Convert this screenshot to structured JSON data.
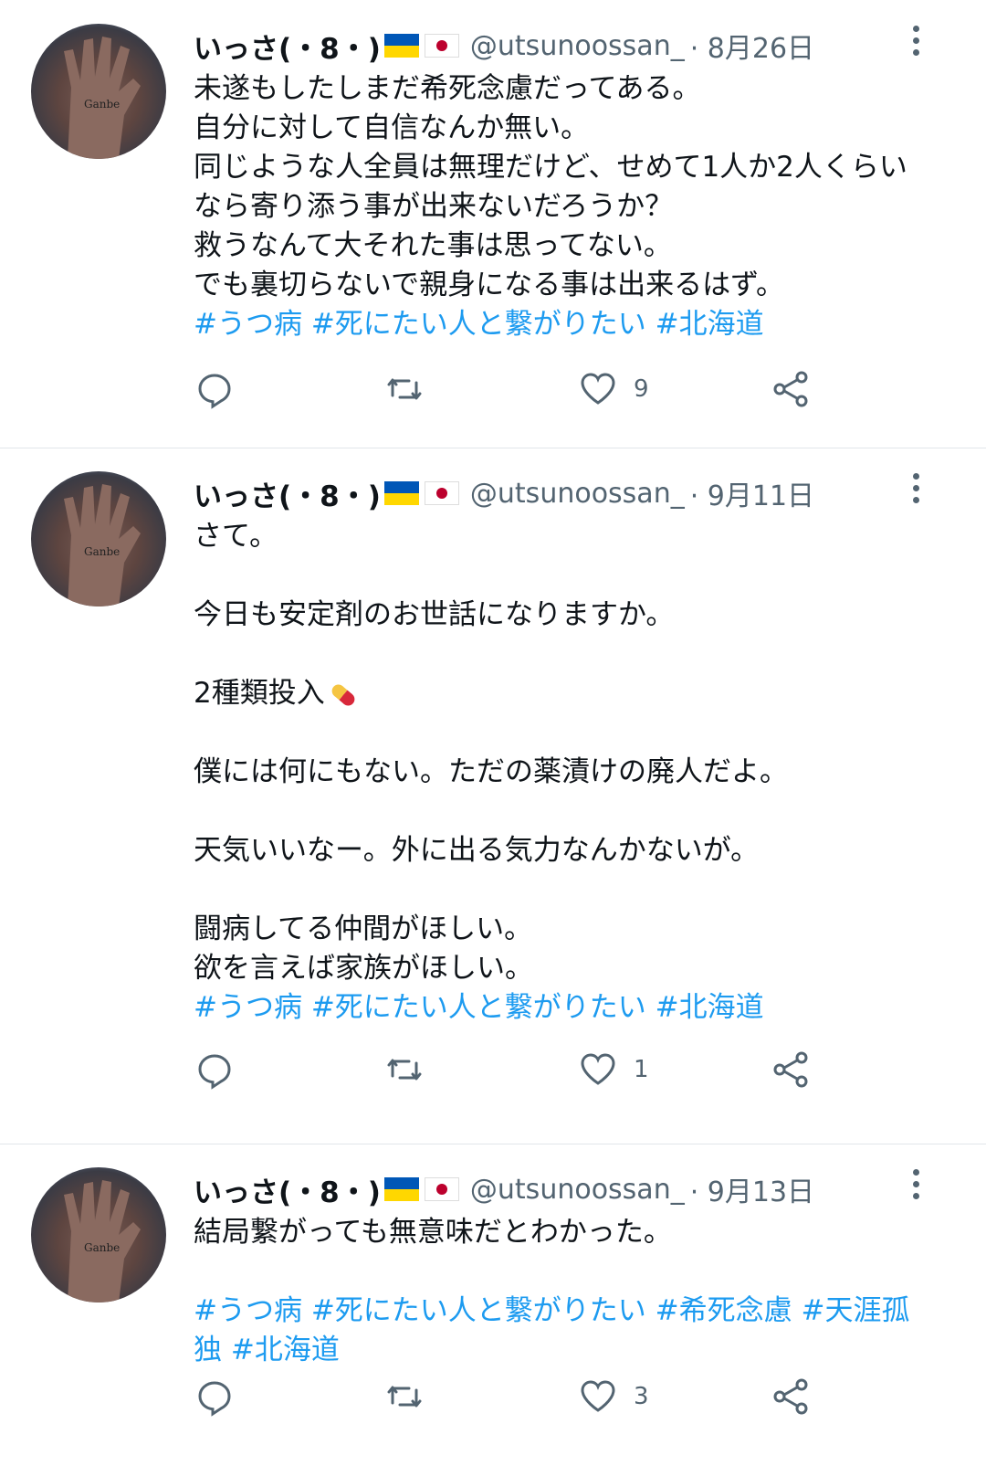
{
  "tweets": [
    {
      "name": "いっさ(・8・)",
      "handle": "@utsunoossan_",
      "date": "· 8月26日",
      "lines": [
        "未遂もしたしまだ希死念慮だってある。",
        "自分に対して自信なんか無い。",
        "同じような人全員は無理だけど、せめて1人か2人くらい",
        "なら寄り添う事が出来ないだろうか？",
        "救うなんて大それた事は思ってない。",
        "でも裏切らないで親身になる事は出来るはず。"
      ],
      "hashtags": "#うつ病 #死にたい人と繋がりたい #北海道",
      "likes": "9"
    },
    {
      "name": "いっさ(・8・)",
      "handle": "@utsunoossan_",
      "date": "· 9月11日",
      "lines": [
        "さて。",
        "",
        "今日も安定剤のお世話になりますか。",
        "",
        "2種類投入",
        "",
        "僕には何にもない。ただの薬漬けの廃人だよ。",
        "",
        "天気いいなー。外に出る気力なんかないが。",
        "",
        "闘病してる仲間がほしい。",
        "欲を言えば家族がほしい。"
      ],
      "hashtags": "#うつ病 #死にたい人と繋がりたい #北海道",
      "likes": "1"
    },
    {
      "name": "いっさ(・8・)",
      "handle": "@utsunoossan_",
      "date": "· 9月13日",
      "lines": [
        "結局繋がっても無意味だとわかった。",
        ""
      ],
      "hashtags_lines": [
        "#うつ病 #死にたい人と繋がりたい #希死念慮 #天涯孤",
        "独 #北海道"
      ],
      "likes": "3"
    }
  ],
  "colors": {
    "link": "#1d9bf0",
    "muted": "#536471",
    "text": "#0f1419"
  },
  "icons": [
    "reply-icon",
    "retweet-icon",
    "like-icon",
    "share-icon",
    "more-icon",
    "pill-emoji",
    "flag-ukraine",
    "flag-japan"
  ]
}
